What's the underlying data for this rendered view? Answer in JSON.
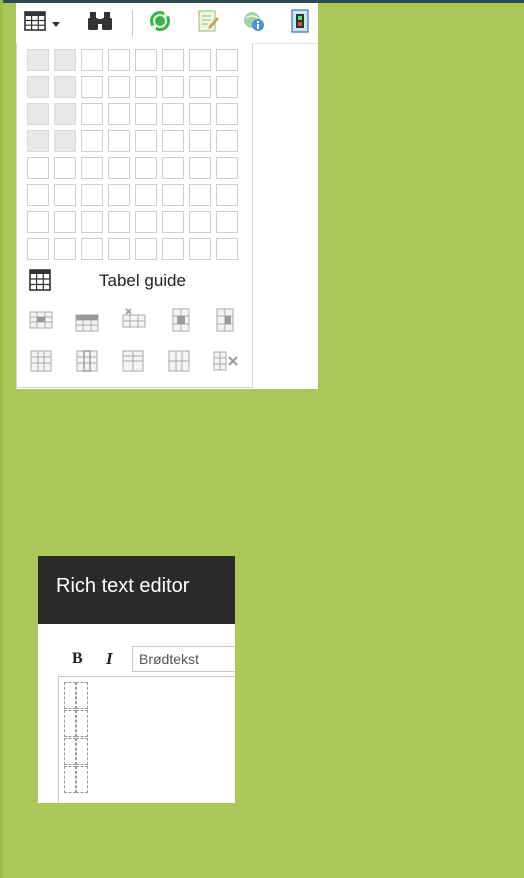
{
  "toolbar": {
    "buttons": [
      {
        "icon": "table-grid-icon",
        "has_dropdown": true
      },
      {
        "icon": "binoculars-icon"
      },
      {
        "icon": "refresh-globe-icon"
      },
      {
        "icon": "edit-document-icon"
      },
      {
        "icon": "web-info-icon"
      },
      {
        "icon": "film-document-icon"
      }
    ]
  },
  "table_picker": {
    "columns": 8,
    "rows": 8,
    "selected_columns": 2,
    "selected_rows": 4,
    "guide_label": "Tabel guide",
    "tools_row1": [
      "insert-row-before-icon",
      "insert-row-after-icon",
      "delete-row-icon",
      "insert-column-before-icon",
      "insert-column-after-icon"
    ],
    "tools_row2": [
      "table-properties-icon",
      "cell-properties-icon",
      "row-properties-icon",
      "column-properties-icon",
      "delete-table-icon"
    ]
  },
  "rich_text_editor": {
    "title": "Rich text editor",
    "bold_label": "B",
    "italic_label": "I",
    "format_select": "Brødtekst",
    "content_table": {
      "columns": 2,
      "rows": 4
    }
  },
  "colors": {
    "background": "#acc657",
    "header_dark": "#2a2a2a",
    "grid_selected": "#e8e8e8"
  }
}
